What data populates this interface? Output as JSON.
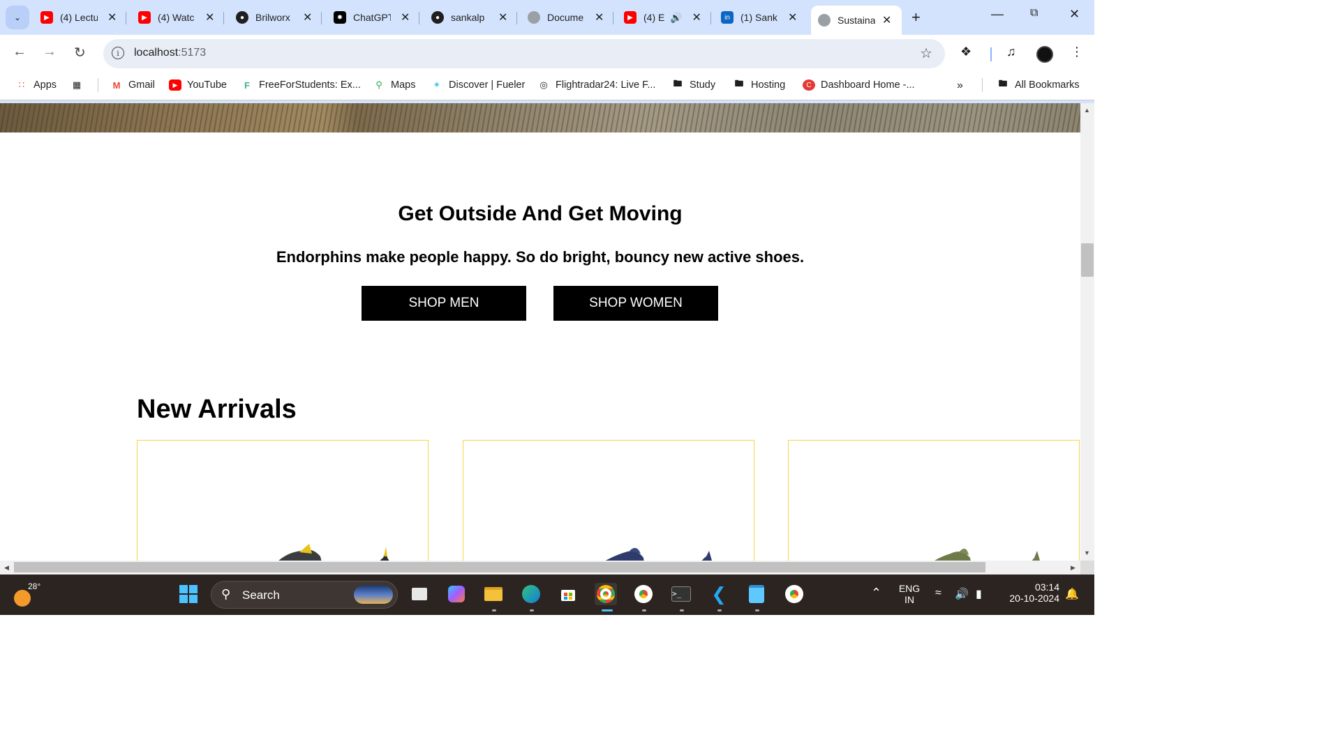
{
  "browser": {
    "tabs": [
      {
        "label": "(4) Lectu",
        "icon": "youtube-icon",
        "color": "#ff0000"
      },
      {
        "label": "(4) Watc",
        "icon": "youtube-icon",
        "color": "#ff0000"
      },
      {
        "label": "Brilworx",
        "icon": "github-icon",
        "color": "#1f1f1f"
      },
      {
        "label": "ChatGPT",
        "icon": "chatgpt-icon",
        "color": "#000000"
      },
      {
        "label": "sankalp",
        "icon": "github-icon",
        "color": "#1f1f1f"
      },
      {
        "label": "Docume",
        "icon": "globe-icon",
        "color": "#9aa0a6"
      },
      {
        "label": "(4) E",
        "icon": "youtube-icon",
        "color": "#ff0000"
      },
      {
        "label": "(1) Sank",
        "icon": "linkedin-icon",
        "color": "#0a66c2"
      },
      {
        "label": "Sustaina",
        "icon": "globe-icon",
        "color": "#9aa0a6",
        "active": true
      }
    ],
    "address": {
      "host": "localhost",
      "port": ":5173"
    },
    "bookmarks": [
      {
        "label": "Apps",
        "icon": "apps-grid-icon"
      },
      {
        "label": "",
        "icon": "tab-groups-icon"
      },
      {
        "label": "Gmail",
        "icon": "gmail-icon"
      },
      {
        "label": "YouTube",
        "icon": "youtube-icon"
      },
      {
        "label": "FreeForStudents: Ex...",
        "icon": "freeforstudents-icon"
      },
      {
        "label": "Maps",
        "icon": "maps-icon"
      },
      {
        "label": "Discover | Fueler",
        "icon": "fueler-icon"
      },
      {
        "label": "Flightradar24: Live F...",
        "icon": "flightradar-icon"
      },
      {
        "label": "Study",
        "icon": "folder-icon"
      },
      {
        "label": "Hosting",
        "icon": "folder-icon"
      },
      {
        "label": "Dashboard Home -...",
        "icon": "dashboard-icon"
      },
      {
        "label": "All Bookmarks",
        "icon": "folder-icon"
      }
    ]
  },
  "page": {
    "heading": "Get Outside And Get Moving",
    "subheading": "Endorphins make people happy. So do bright, bouncy new active shoes.",
    "shop_men": "SHOP MEN",
    "shop_women": "SHOP WOMEN",
    "arrivals_title": "New Arrivals",
    "products": [
      {
        "shoe_color": "#3a3d40",
        "accent": "#e8c21a"
      },
      {
        "shoe_color": "#2e3b6b",
        "accent": "#2e3b6b"
      },
      {
        "shoe_color": "#6e7a4a",
        "accent": "#6e7a4a"
      }
    ]
  },
  "taskbar": {
    "temperature": "28°",
    "search_placeholder": "Search",
    "lang_line1": "ENG",
    "lang_line2": "IN",
    "time": "03:14",
    "date": "20-10-2024"
  }
}
